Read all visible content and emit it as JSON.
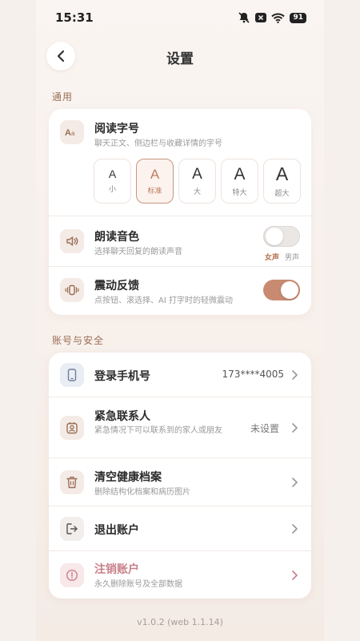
{
  "status": {
    "time": "15:31",
    "battery": "91"
  },
  "nav": {
    "title": "设置"
  },
  "sections": {
    "general": "通用",
    "account": "账号与安全"
  },
  "font_size": {
    "title": "阅读字号",
    "subtitle": "聊天正文、侧边栏与收藏详情的字号",
    "options": [
      {
        "glyph": "A",
        "label": "小"
      },
      {
        "glyph": "A",
        "label": "标准"
      },
      {
        "glyph": "A",
        "label": "大"
      },
      {
        "glyph": "A",
        "label": "特大"
      },
      {
        "glyph": "A",
        "label": "超大"
      }
    ],
    "selected": "标准"
  },
  "voice": {
    "title": "朗读音色",
    "subtitle": "选择聊天回复的朗读声音",
    "female": "女声",
    "male": "男声",
    "selected": "女声"
  },
  "vibration": {
    "title": "震动反馈",
    "subtitle": "点按钮、滚选择、AI 打字时的轻微震动",
    "enabled": true
  },
  "account": {
    "phone": {
      "title": "登录手机号",
      "value": "173****4005"
    },
    "emergency": {
      "title": "紧急联系人",
      "subtitle": "紧急情况下可以联系到的家人或朋友",
      "value": "未设置"
    },
    "clear": {
      "title": "清空健康档案",
      "subtitle": "删除结构化档案和病历图片"
    },
    "logout": {
      "title": "退出账户"
    },
    "delete": {
      "title": "注销账户",
      "subtitle": "永久删除账号及全部数据"
    }
  },
  "version": "v1.0.2 (web 1.1.14)",
  "colors": {
    "accent": "#c88a71",
    "danger": "#c87f88",
    "section": "#9b6e55"
  }
}
